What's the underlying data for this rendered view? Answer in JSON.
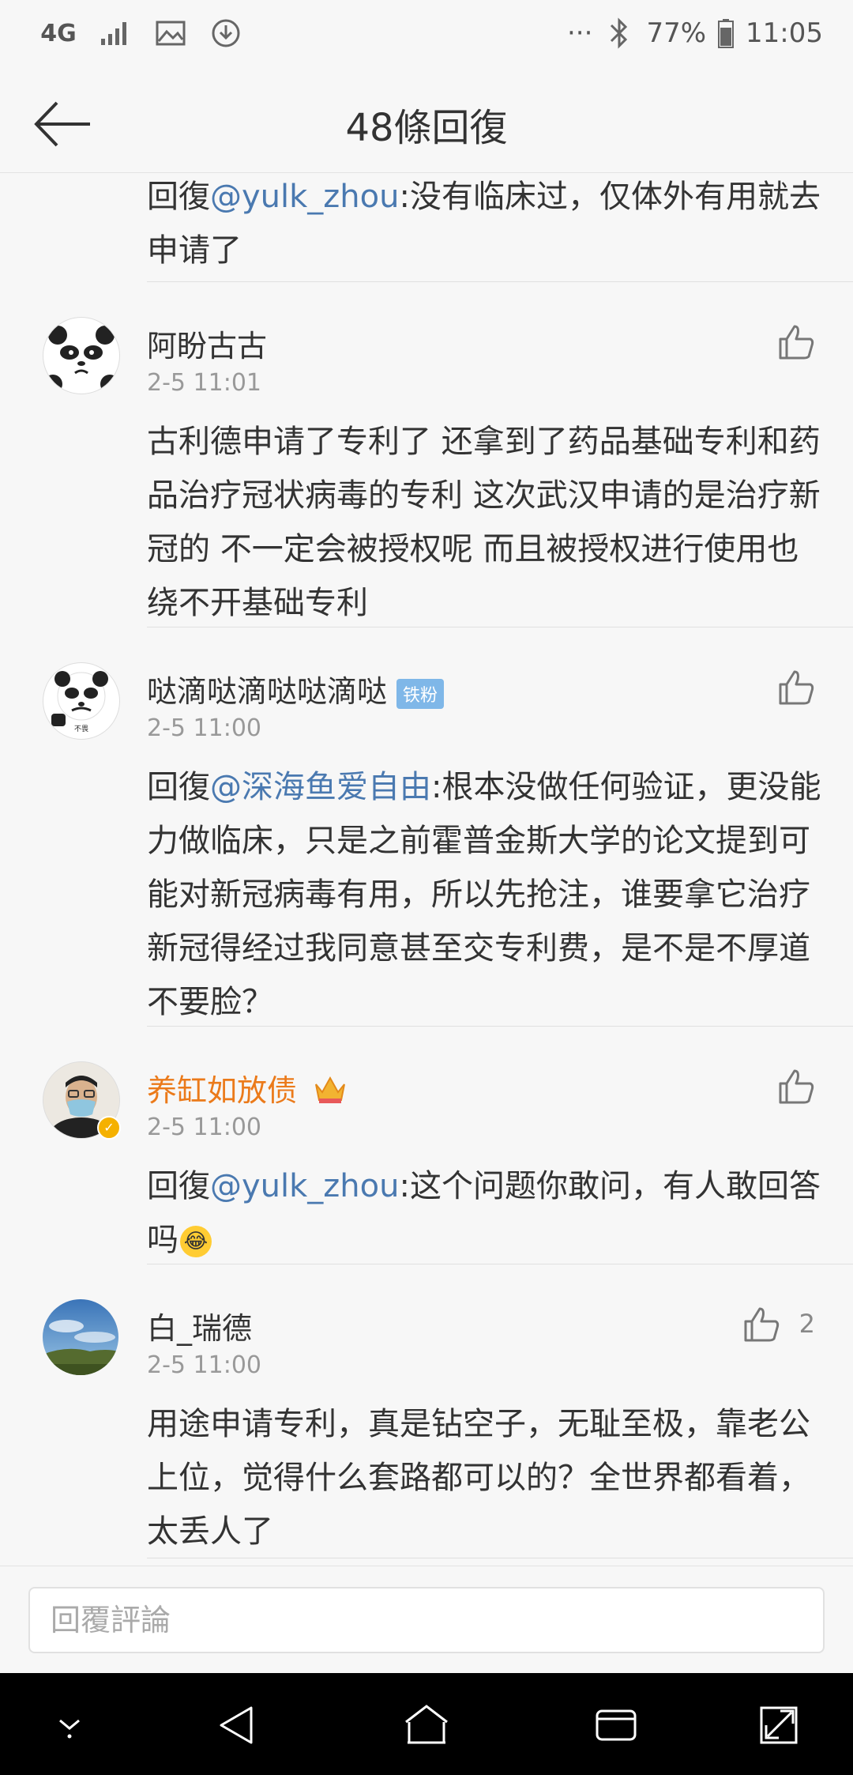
{
  "status_bar": {
    "network": "4G",
    "dots": "···",
    "battery": "77%",
    "time": "11:05"
  },
  "header": {
    "title": "48條回復"
  },
  "top_fragment": {
    "prefix": "回復",
    "mention": "@yulk_zhou",
    "text": ":没有临床过，仅体外有用就去申请了"
  },
  "comments": [
    {
      "name": "阿盼古古",
      "time": "2-5 11:01",
      "content": "古利德申请了专利了 还拿到了药品基础专利和药品治疗冠状病毒的专利 这次武汉申请的是治疗新冠的 不一定会被授权呢 而且被授权进行使用也绕不开基础专利"
    },
    {
      "name": "哒滴哒滴哒哒滴哒",
      "badge": "铁粉",
      "avatar_caption": "不畏",
      "time": "2-5 11:00",
      "prefix": "回復",
      "mention": "@深海鱼爱自由",
      "content": ":根本没做任何验证，更没能力做临床，只是之前霍普金斯大学的论文提到可能对新冠病毒有用，所以先抢注，谁要拿它治疗新冠得经过我同意甚至交专利费，是不是不厚道不要脸？"
    },
    {
      "name": "养缸如放债",
      "time": "2-5 11:00",
      "prefix": "回復",
      "mention": "@yulk_zhou",
      "content": ":这个问题你敢问，有人敢回答吗"
    },
    {
      "name": "白_瑞德",
      "time": "2-5 11:00",
      "likes": "2",
      "content": "用途申请专利，真是钻空子，无耻至极，靠老公上位，觉得什么套路都可以的？全世界都看着，太丢人了"
    }
  ],
  "reply_bar": {
    "placeholder": "回覆評論"
  },
  "colors": {
    "mention": "#4a79b0",
    "vip_name": "#eb7a1a",
    "badge": "#7fb7e8"
  }
}
